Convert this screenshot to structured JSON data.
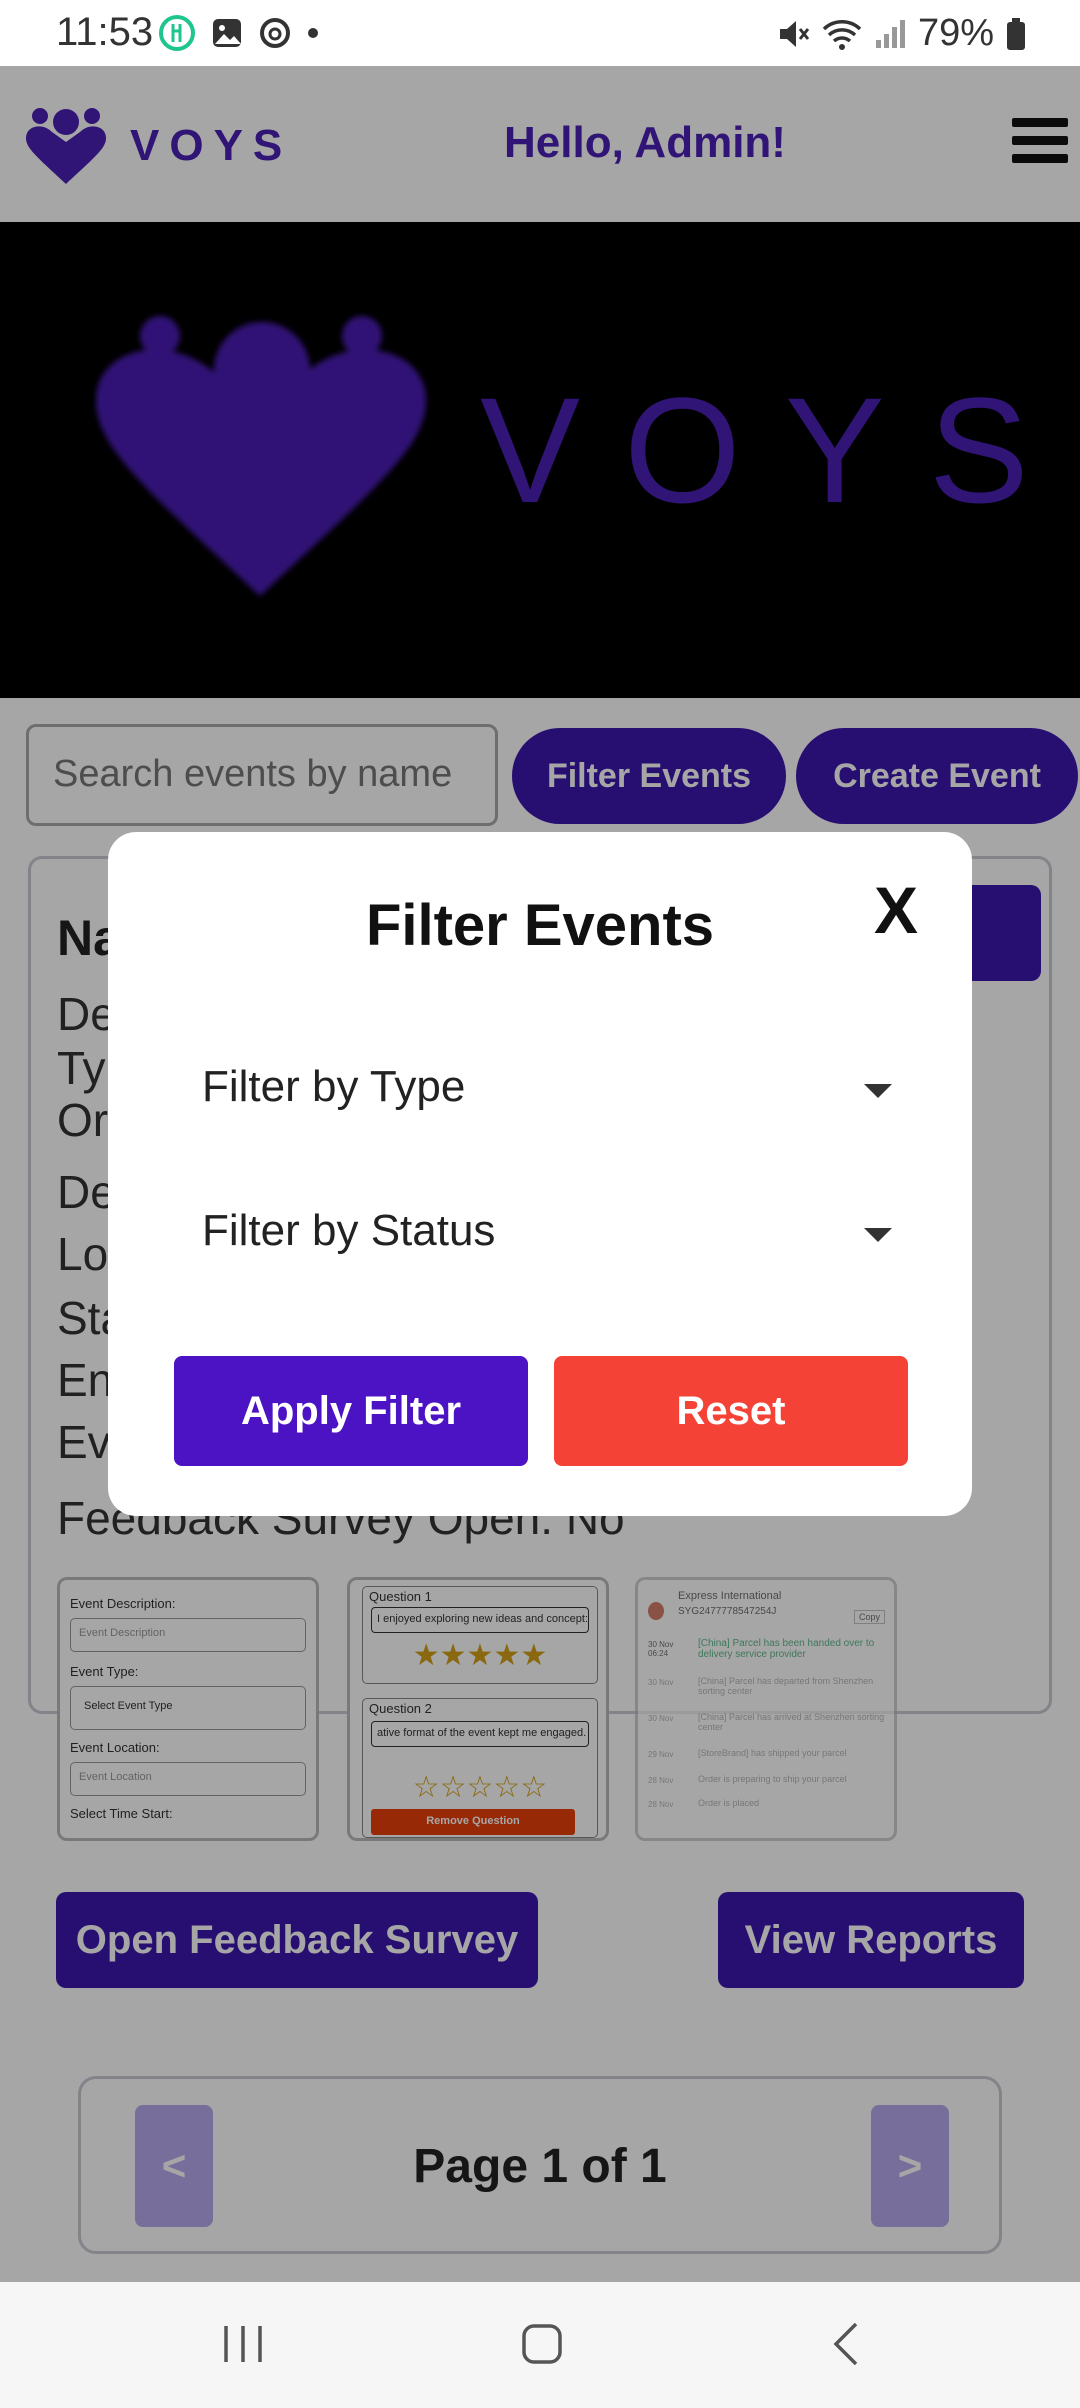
{
  "status_bar": {
    "time": "11:53",
    "battery": "79%",
    "icons": [
      "food-app-icon",
      "gallery-icon",
      "threads-icon",
      "dot-icon",
      "mute-icon",
      "wifi-icon",
      "signal-icon",
      "battery-icon"
    ]
  },
  "header": {
    "brand": "VOYS",
    "greeting": "Hello, Admin!",
    "menu_icon": "hamburger-icon"
  },
  "hero": {
    "brand": "VOYS"
  },
  "toolbar": {
    "search_placeholder": "Search events by name",
    "filter_label": "Filter Events",
    "create_label": "Create Event"
  },
  "event_card": {
    "name_partial": "Na",
    "lines_partial": [
      "De",
      "Ty",
      "Org",
      "De",
      "Lo",
      "Sta",
      "En",
      "Eve"
    ],
    "feedback_line": "Feedback Survey Open: No",
    "thumb1": {
      "desc_label": "Event Description:",
      "desc_placeholder": "Event Description",
      "type_label": "Event Type:",
      "type_select": "Select Event Type",
      "loc_label": "Event Location:",
      "loc_placeholder": "Event Location",
      "time_label": "Select Time Start:"
    },
    "thumb2": {
      "q1_label": "Question 1",
      "q1_text": "I enjoyed exploring new ideas and concept:",
      "q2_label": "Question 2",
      "q2_text": "ative format of the event kept me engaged.",
      "remove_label": "Remove Question"
    },
    "thumb3": {
      "carrier": "Express International",
      "tracking": "SYG2477778547254J",
      "copy": "Copy",
      "events": [
        {
          "date": "30 Nov 06:24",
          "text": "[China] Parcel has been handed over to delivery service provider"
        },
        {
          "date": "30 Nov",
          "text": "[China] Parcel has departed from Shenzhen sorting center"
        },
        {
          "date": "30 Nov",
          "text": "[China] Parcel has arrived at Shenzhen sorting center"
        },
        {
          "date": "29 Nov",
          "text": "[StoreBrand] has shipped your parcel"
        },
        {
          "date": "28 Nov",
          "text": "Order is preparing to ship your parcel"
        },
        {
          "date": "28 Nov",
          "text": "Order is placed"
        }
      ]
    },
    "open_survey_label": "Open Feedback Survey",
    "view_reports_label": "View Reports"
  },
  "pager": {
    "prev": "<",
    "next": ">",
    "text": "Page 1 of 1"
  },
  "modal": {
    "title": "Filter Events",
    "close": "X",
    "type_select": "Filter by Type",
    "status_select": "Filter by Status",
    "apply_label": "Apply Filter",
    "reset_label": "Reset"
  },
  "colors": {
    "brand_purple": "#3d17b0",
    "apply_purple": "#4b13c4",
    "reset_red": "#f44336"
  }
}
